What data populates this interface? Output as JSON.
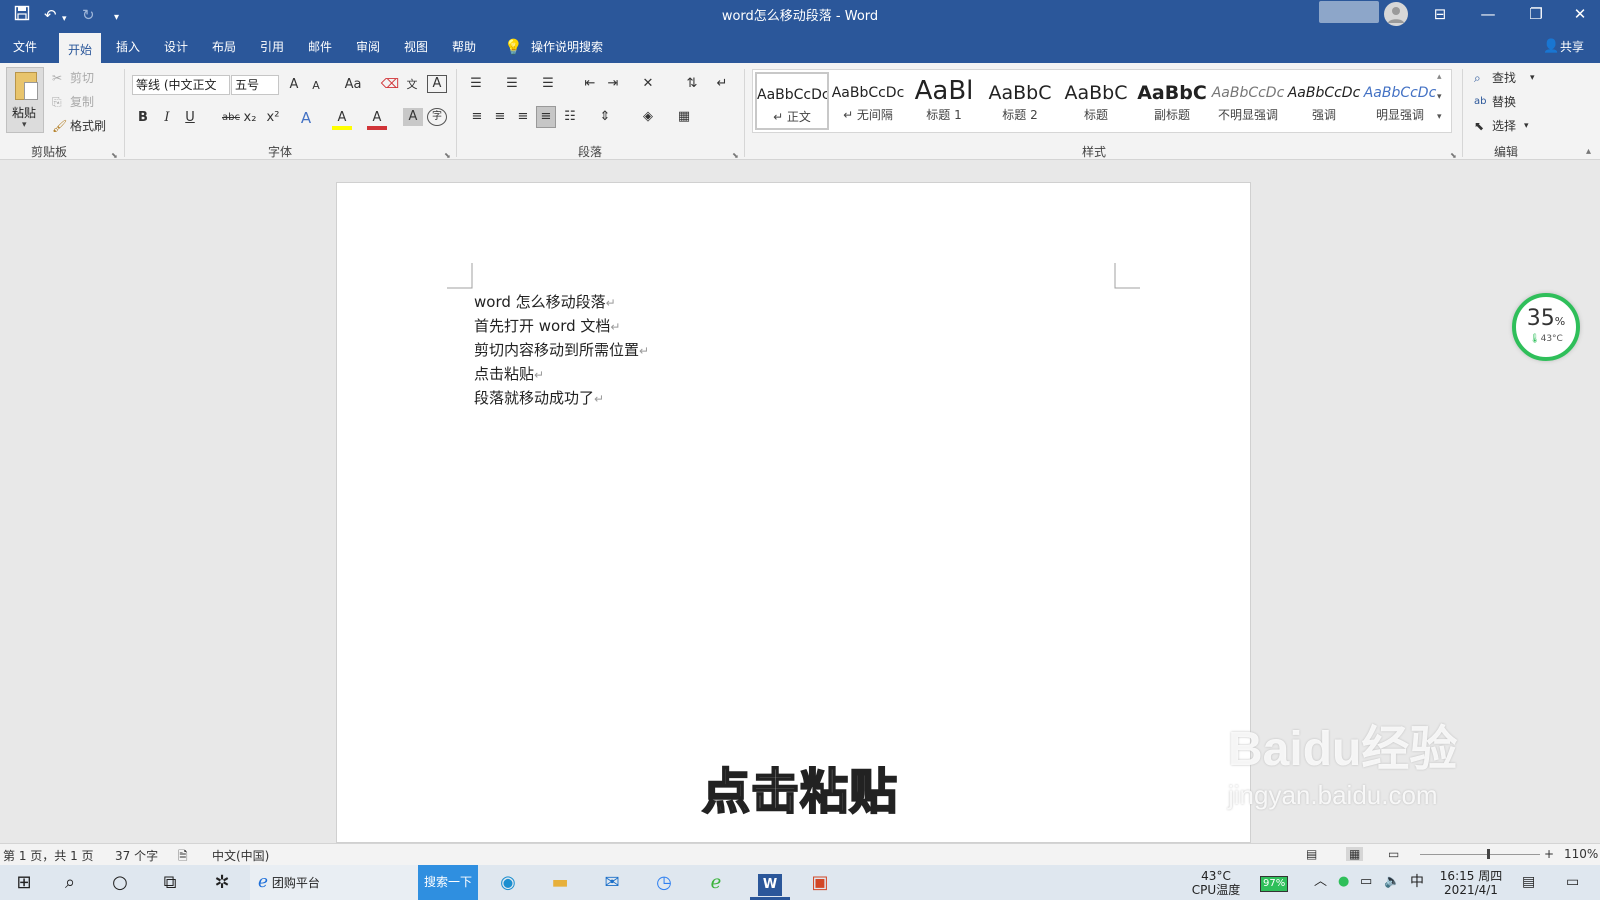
{
  "window": {
    "title": "word怎么移动段落 - Word"
  },
  "quick_access": {
    "save_icon": "save-icon",
    "undo_icon": "undo-icon",
    "redo_icon": "redo-icon",
    "customize_icon": "chevron-down-icon"
  },
  "tabs": [
    "文件",
    "开始",
    "插入",
    "设计",
    "布局",
    "引用",
    "邮件",
    "审阅",
    "视图",
    "帮助"
  ],
  "active_tab": "开始",
  "tell_me": "操作说明搜索",
  "share": "共享",
  "clipboard": {
    "paste": "粘贴",
    "cut": "剪切",
    "copy": "复制",
    "format_painter": "格式刷",
    "label": "剪贴板"
  },
  "font": {
    "name": "等线 (中文正文",
    "size": "五号",
    "label": "字体",
    "aa": "Aa",
    "grow": "A",
    "shrink": "A",
    "bold": "B",
    "italic": "I",
    "underline": "U",
    "strike": "abc",
    "sub": "x₂",
    "sup": "x²",
    "effect": "A",
    "border": "A",
    "phonetic": "文",
    "highlight": "A"
  },
  "paragraph": {
    "label": "段落"
  },
  "styles": {
    "label": "样式",
    "items": [
      {
        "sample": "AaBbCcDc",
        "name": "↵ 正文"
      },
      {
        "sample": "AaBbCcDc",
        "name": "↵ 无间隔"
      },
      {
        "sample": "AaBl",
        "name": "标题 1"
      },
      {
        "sample": "AaBbC",
        "name": "标题 2"
      },
      {
        "sample": "AaBbC",
        "name": "标题"
      },
      {
        "sample": "AaBbC",
        "name": "副标题"
      },
      {
        "sample": "AaBbCcDc",
        "name": "不明显强调"
      },
      {
        "sample": "AaBbCcDc",
        "name": "强调"
      },
      {
        "sample": "AaBbCcDc",
        "name": "明显强调"
      }
    ]
  },
  "editing": {
    "find": "查找",
    "replace": "替换",
    "select": "选择",
    "label": "编辑"
  },
  "document": {
    "lines": [
      "word 怎么移动段落",
      "首先打开 word 文档",
      "剪切内容移动到所需位置",
      "点击粘贴",
      "段落就移动成功了"
    ],
    "mark": "↵"
  },
  "caption": "点击粘贴",
  "cpu_widget": {
    "percent": "35",
    "unit": "%",
    "temp": "43°C"
  },
  "watermark": {
    "brand": "Baidu经验",
    "url": "jingyan.baidu.com"
  },
  "status": {
    "page": "第 1 页，共 1 页",
    "words": "37 个字",
    "language": "中文(中国)",
    "zoom": "110%",
    "zoom_plus": "+"
  },
  "taskbar": {
    "browser_tab": "团购平台",
    "search_button": "搜索一下",
    "cpu_temp": "43°C",
    "cpu_label": "CPU温度",
    "battery": "97%",
    "ime": "中",
    "time": "16:15 周四",
    "date": "2021/4/1"
  },
  "colors": {
    "word_blue": "#2b579a",
    "ribbon_bg": "#f3f3f3",
    "canvas_bg": "#e8e8e8",
    "cpu_ring": "#2fbf5a",
    "search_btn": "#2f8fe0"
  }
}
